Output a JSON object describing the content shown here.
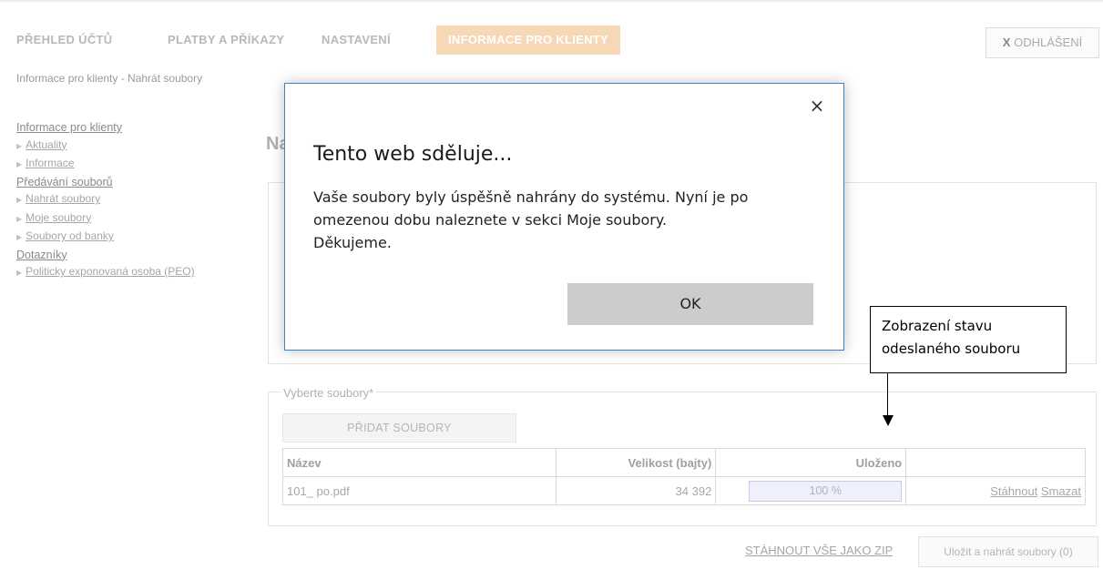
{
  "nav": {
    "items": [
      "PŘEHLED ÚČTŮ",
      "PLATBY A PŘÍKAZY",
      "NASTAVENÍ",
      "INFORMACE PRO KLIENTY"
    ],
    "active_index": 3,
    "logout_x": "X",
    "logout_label": "ODHLÁŠENÍ"
  },
  "breadcrumb": "Informace pro klienty - Nahrát soubory",
  "sidebar": {
    "section1": "Informace pro klienty",
    "s1_items": [
      "Aktuality",
      "Informace"
    ],
    "section2": "Předávání souborů",
    "s2_items": [
      "Nahrát soubory",
      "Moje soubory",
      "Soubory od banky"
    ],
    "section3": "Dotazníky",
    "s3_items": [
      "Politicky exponovaná osoba (PEO)"
    ]
  },
  "main": {
    "title_fragment": "Na",
    "files_legend": "Vyberte soubory*",
    "add_files_label": "PŘIDAT SOUBORY",
    "table": {
      "headers": [
        "Název",
        "Velikost (bajty)",
        "Uloženo",
        ""
      ],
      "rows": [
        {
          "name": "101_ po.pdf",
          "size": "34 392",
          "saved": "100 %",
          "progress": 1.0,
          "download": "Stáhnout",
          "delete": "Smazat"
        }
      ]
    },
    "zip_label": "STÁHNOUT VŠE JAKO ZIP",
    "save_label": "Uložit a nahrát soubory (0)"
  },
  "dialog": {
    "close_glyph": "×",
    "title": "Tento web sděluje...",
    "message_lines": [
      "Vaše soubory byly úspěšně nahrány do systému. Nyní je po",
      "omezenou dobu naleznete v sekci Moje soubory.",
      "Děkujeme."
    ],
    "ok_label": "OK"
  },
  "callout": {
    "lines": [
      "Zobrazení stavu",
      "odeslaného souboru"
    ]
  },
  "colors": {
    "active_tab_bg": "#f6d8b6",
    "dialog_border": "#3c82c8",
    "ok_button_bg": "#cccccc",
    "progress_bg": "#f0f0fb"
  }
}
